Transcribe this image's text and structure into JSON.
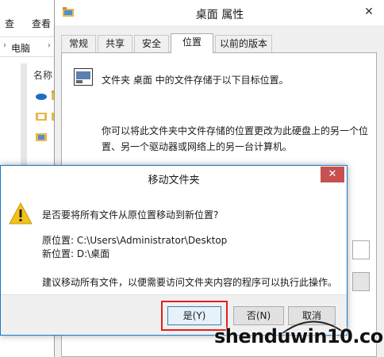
{
  "explorer": {
    "menu_left": "查",
    "menu_right": "查看",
    "address": "电脑",
    "address_next": "›",
    "column_header": "名称"
  },
  "properties": {
    "title": "桌面 属性",
    "tabs": [
      {
        "label": "常规"
      },
      {
        "label": "共享"
      },
      {
        "label": "安全"
      },
      {
        "label": "位置"
      },
      {
        "label": "以前的版本"
      }
    ],
    "location_text": "文件夹 桌面 中的文件存储于以下目标位置。",
    "description": "你可以将此文件夹中文件存储的位置更改为此硬盘上的另一个位置、另一个驱动器或网络上的另一台计算机。"
  },
  "dialog": {
    "title": "移动文件夹",
    "question": "是否要将所有文件从原位置移动到新位置?",
    "original_location": "原位置: C:\\Users\\Administrator\\Desktop",
    "new_location": "新位置: D:\\桌面",
    "advice": "建议移动所有文件，以便需要访问文件夹内容的程序可以执行此操作。",
    "buttons": {
      "yes": "是(Y)",
      "no": "否(N)",
      "cancel": "取消"
    },
    "close_glyph": "✕"
  },
  "watermark": "shenduwin10.com",
  "colors": {
    "dialog_border": "#1979ca",
    "close_button": "#c75050",
    "highlight_box": "#e02020"
  }
}
